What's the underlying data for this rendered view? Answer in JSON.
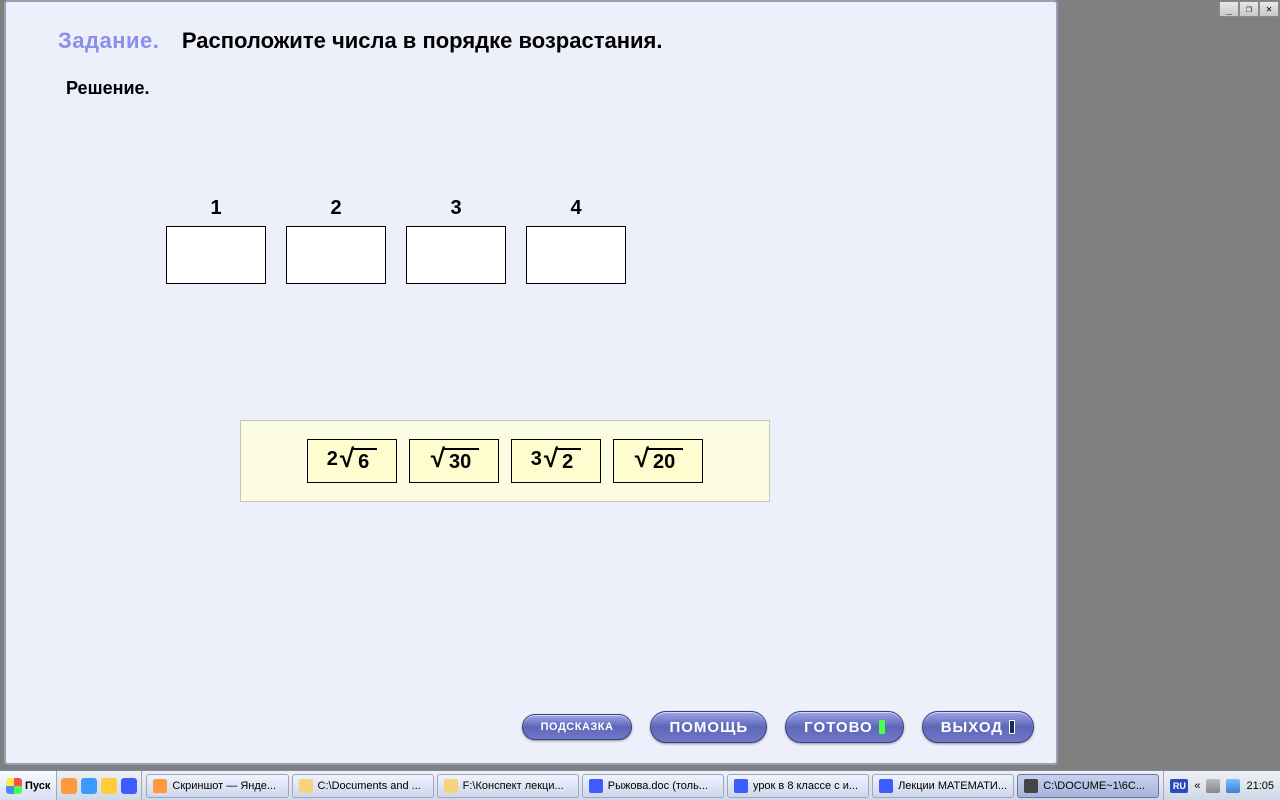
{
  "window_controls": {
    "minimize": "_",
    "restore": "❐",
    "close": "✕"
  },
  "task": {
    "label": "Задание.",
    "text": "Расположите числа в порядке возрастания.",
    "solution_label": "Решение."
  },
  "slots": [
    "1",
    "2",
    "3",
    "4"
  ],
  "tiles": [
    {
      "coef": "2",
      "radicand": "6"
    },
    {
      "coef": "",
      "radicand": "30"
    },
    {
      "coef": "3",
      "radicand": "2"
    },
    {
      "coef": "",
      "radicand": "20"
    }
  ],
  "buttons": {
    "hint": "ПОДСКАЗКА",
    "help": "ПОМОЩЬ",
    "done": "ГОТОВО",
    "exit": "ВЫХОД"
  },
  "taskbar": {
    "start": "Пуск",
    "items": [
      "Скриншот — Янде...",
      "C:\\Documents and ...",
      "F:\\Конспект лекци...",
      "Рыжова.doc (толь...",
      "урок в 8 классе с и...",
      "Лекции МАТЕМАТИ...",
      "C:\\DOCUME~1\\6C..."
    ],
    "lang": "RU",
    "chev": "«",
    "clock": "21:05"
  },
  "colors": {
    "ql_firefox": "#ff9a3c",
    "ql_ie": "#3c9aff",
    "ql_mail": "#ffcc3c",
    "ql_word": "#3c5cff",
    "ti_firefox": "#ff9a3c",
    "ti_folder": "#f5d47a",
    "ti_word": "#3c5cff",
    "ti_app": "#444444"
  }
}
